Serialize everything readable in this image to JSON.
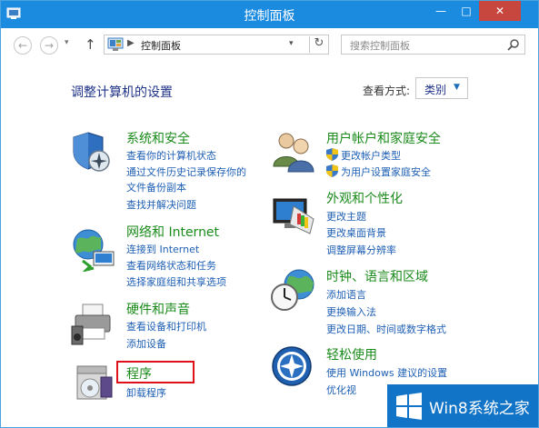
{
  "window": {
    "title": "控制面板",
    "buttons": {
      "minimize": "—",
      "maximize": "□",
      "close": "✕"
    }
  },
  "toolbar": {
    "address_text": "控制面板",
    "search_placeholder": "搜索控制面板"
  },
  "header": {
    "page_title": "调整计算机的设置",
    "view_by_label": "查看方式:",
    "view_by_value": "类别"
  },
  "categories": {
    "system_security": {
      "title": "系统和安全",
      "links": [
        "查看你的计算机状态",
        "通过文件历史记录保存你的",
        "文件备份副本",
        "查找并解决问题"
      ]
    },
    "network": {
      "title": "网络和 Internet",
      "links": [
        "连接到 Internet",
        "查看网络状态和任务",
        "选择家庭组和共享选项"
      ]
    },
    "hardware": {
      "title": "硬件和声音",
      "links": [
        "查看设备和打印机",
        "添加设备"
      ]
    },
    "programs": {
      "title": "程序",
      "links": [
        "卸载程序"
      ]
    },
    "user_accounts": {
      "title": "用户帐户和家庭安全",
      "links": [
        "更改帐户类型",
        "为用户设置家庭安全"
      ]
    },
    "appearance": {
      "title": "外观和个性化",
      "links": [
        "更改主题",
        "更改桌面背景",
        "调整屏幕分辨率"
      ]
    },
    "clock_region": {
      "title": "时钟、语言和区域",
      "links": [
        "添加语言",
        "更换输入法",
        "更改日期、时间或数字格式"
      ]
    },
    "ease_of_access": {
      "title": "轻松使用",
      "links": [
        "使用 Windows 建议的设置",
        "优化视"
      ]
    }
  },
  "watermark": {
    "text": "Win8系统之家"
  },
  "colors": {
    "titlebar": "#1b8be0",
    "category_title": "#1a8a1a",
    "link": "#1e5fb4",
    "highlight": "#e0101b",
    "watermark_bg": "#1274c6"
  }
}
